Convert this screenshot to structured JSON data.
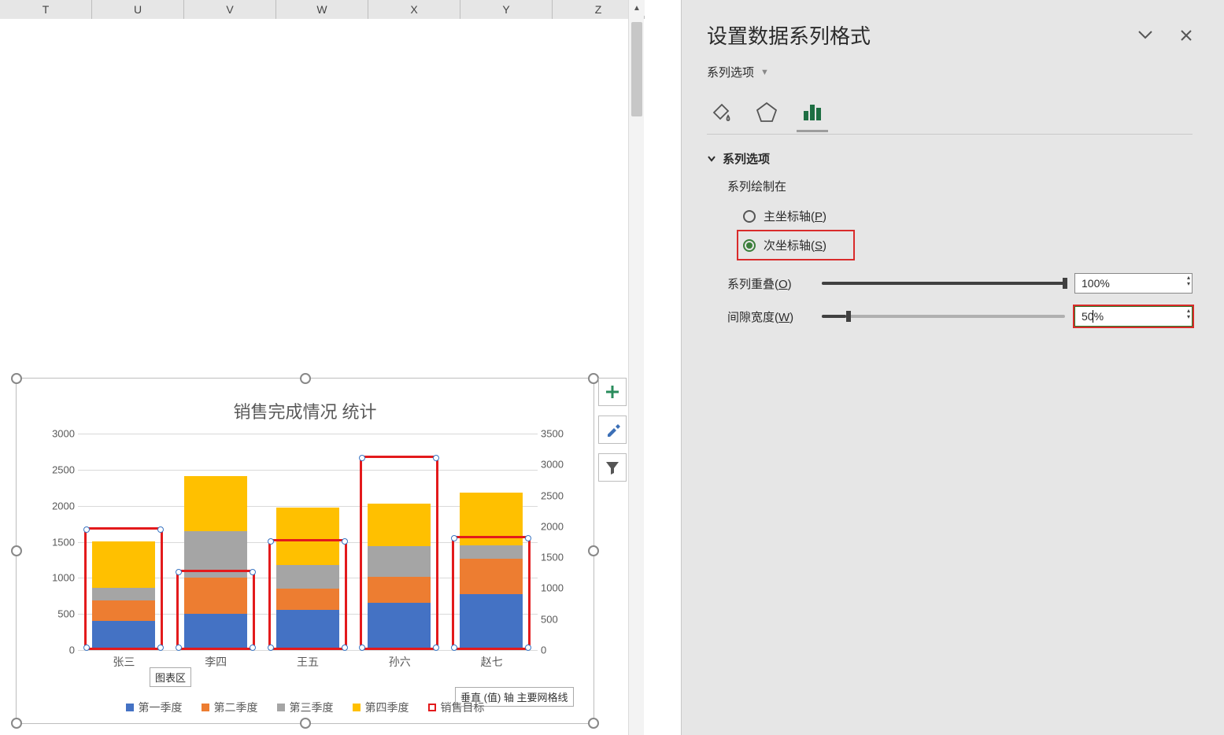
{
  "columns": [
    "T",
    "U",
    "V",
    "W",
    "X",
    "Y",
    "Z"
  ],
  "chart": {
    "title": "销售完成情况 统计",
    "tooltip_area": "图表区",
    "tooltip_gridline": "垂直 (值) 轴 主要网格线"
  },
  "chart_data": {
    "type": "bar",
    "stacked": true,
    "categories": [
      "张三",
      "李四",
      "王五",
      "孙六",
      "赵七"
    ],
    "series": [
      {
        "name": "第一季度",
        "color": "#4472c4",
        "values": [
          400,
          500,
          560,
          650,
          780
        ]
      },
      {
        "name": "第二季度",
        "color": "#ed7d31",
        "values": [
          290,
          500,
          290,
          360,
          490
        ]
      },
      {
        "name": "第三季度",
        "color": "#a5a5a5",
        "values": [
          170,
          650,
          330,
          430,
          180
        ]
      },
      {
        "name": "第四季度",
        "color": "#ffc000",
        "values": [
          650,
          760,
          790,
          590,
          730
        ]
      }
    ],
    "target_series": {
      "name": "销售目标",
      "color": "#e31a1c",
      "values": [
        1980,
        1300,
        1800,
        3150,
        1850
      ]
    },
    "y_axis_left": {
      "min": 0,
      "max": 3000,
      "step": 500,
      "ticks": [
        0,
        500,
        1000,
        1500,
        2000,
        2500,
        3000
      ]
    },
    "y_axis_right": {
      "min": 0,
      "max": 3500,
      "step": 500,
      "ticks": [
        0,
        500,
        1000,
        1500,
        2000,
        2500,
        3000,
        3500
      ]
    },
    "legend": [
      "第一季度",
      "第二季度",
      "第三季度",
      "第四季度",
      "销售目标"
    ]
  },
  "chart_buttons": {
    "add": "+",
    "brush": "brush",
    "filter": "filter"
  },
  "pane": {
    "title": "设置数据系列格式",
    "dropdown": "系列选项",
    "tabs": {
      "fill": "fill-line",
      "effects": "effects",
      "series": "series-options"
    },
    "section_title": "系列选项",
    "plot_on_label": "系列绘制在",
    "primary_axis": "主坐标轴(P)",
    "secondary_axis": "次坐标轴(S)",
    "overlap_label": "系列重叠(O)",
    "overlap_value": "100%",
    "gap_label": "间隙宽度(W)",
    "gap_value": "50%"
  }
}
